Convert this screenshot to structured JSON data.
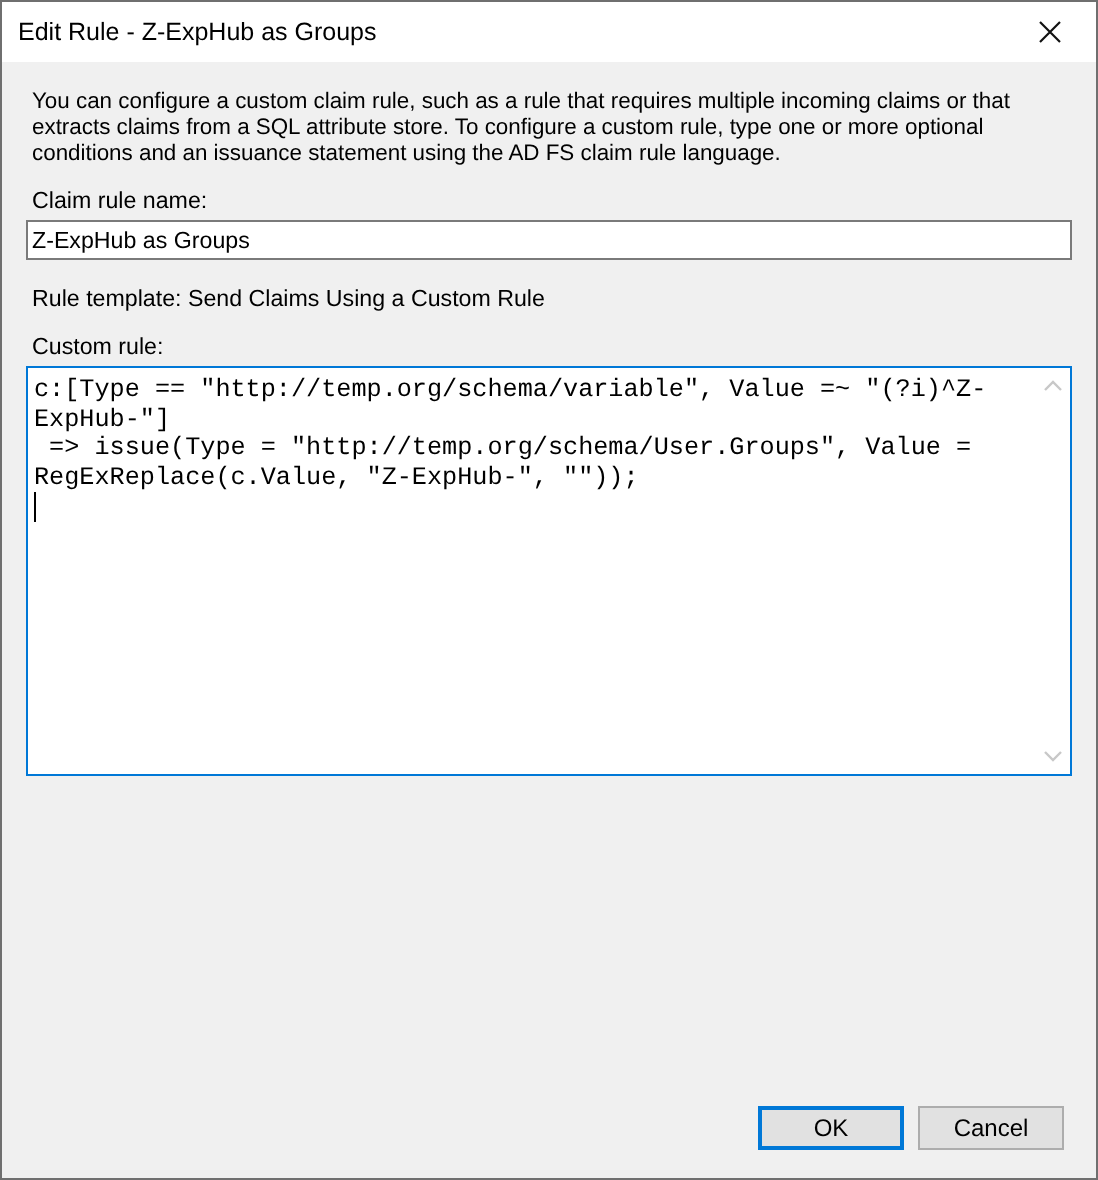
{
  "window": {
    "title": "Edit Rule - Z-ExpHub as Groups"
  },
  "description": "You can configure a custom claim rule, such as a rule that requires multiple incoming claims or that extracts claims from a SQL attribute store. To configure a custom rule, type one or more optional conditions and an issuance statement using the AD FS claim rule language.",
  "claim_rule_name": {
    "label": "Claim rule name:",
    "value": "Z-ExpHub as Groups"
  },
  "rule_template": "Rule template: Send Claims Using a Custom Rule",
  "custom_rule": {
    "label": "Custom rule:",
    "focused": true,
    "lines": [
      "c:[Type == \"http://temp.org/schema/variable\", Value =~ \"(?i)^Z-",
      "ExpHub-\"]",
      " => issue(Type = \"http://temp.org/schema/User.Groups\", Value =",
      "RegExReplace(c.Value, \"Z-ExpHub-\", \"\"));"
    ]
  },
  "buttons": [
    {
      "label": "OK",
      "default": true
    },
    {
      "label": "Cancel",
      "default": false
    }
  ]
}
